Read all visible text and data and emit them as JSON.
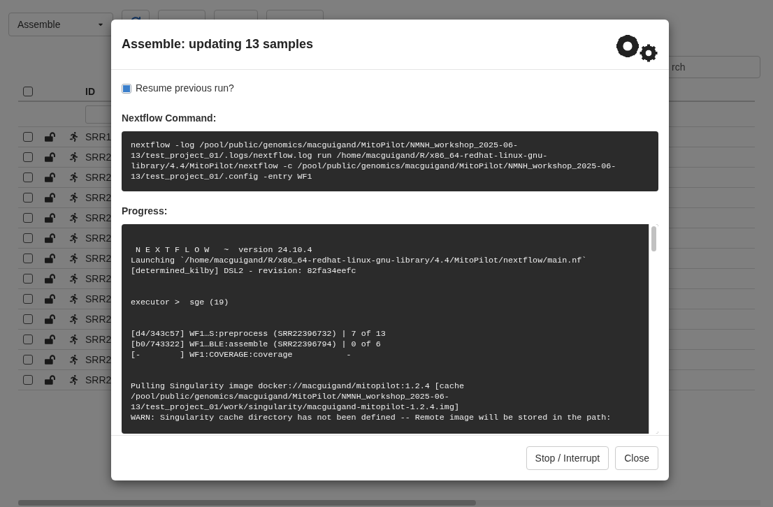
{
  "toolbar": {
    "step_select": "Assemble"
  },
  "search": {
    "placeholder": "rch"
  },
  "table": {
    "header": {
      "checked": false,
      "id_label": "ID"
    },
    "rows": [
      {
        "checked": false,
        "id": "SRR1"
      },
      {
        "checked": false,
        "id": "SRR2"
      },
      {
        "checked": false,
        "id": "SRR2"
      },
      {
        "checked": false,
        "id": "SRR2"
      },
      {
        "checked": false,
        "id": "SRR2"
      },
      {
        "checked": false,
        "id": "SRR2"
      },
      {
        "checked": false,
        "id": "SRR2"
      },
      {
        "checked": false,
        "id": "SRR2"
      },
      {
        "checked": false,
        "id": "SRR2"
      },
      {
        "checked": false,
        "id": "SRR2"
      },
      {
        "checked": false,
        "id": "SRR2"
      },
      {
        "checked": false,
        "id": "SRR2"
      },
      {
        "checked": false,
        "id": "SRR2"
      }
    ]
  },
  "dialog": {
    "title": "Assemble: updating 13 samples",
    "resume": {
      "label": "Resume previous run?",
      "checked": true
    },
    "command_label": "Nextflow Command:",
    "command_lines": [
      "nextflow -log /pool/public/genomics/macguigand/MitoPilot/NMNH_workshop_2025-06-",
      "13/test_project_01/.logs/nextflow.log run /home/macguigand/R/x86_64-redhat-linux-gnu-",
      "library/4.4/MitoPilot/nextflow -c /pool/public/genomics/macguigand/MitoPilot/NMNH_workshop_2025-06-",
      "13/test_project_01/.config -entry WF1"
    ],
    "progress_label": "Progress:",
    "progress_blocks": [
      [
        " N E X T F L O W   ~  version 24.10.4",
        "Launching `/home/macguigand/R/x86_64-redhat-linux-gnu-library/4.4/MitoPilot/nextflow/main.nf`",
        "[determined_kilby] DSL2 - revision: 82fa34eefc"
      ],
      [
        "executor >  sge (19)"
      ],
      [
        "[d4/343c57] WF1…S:preprocess (SRR22396732) | 7 of 13",
        "[b0/743322] WF1…BLE:assemble (SRR22396794) | 0 of 6",
        "[-        ] WF1:COVERAGE:coverage           -"
      ],
      [
        "Pulling Singularity image docker://macguigand/mitopilot:1.2.4 [cache",
        "/pool/public/genomics/macguigand/MitoPilot/NMNH_workshop_2025-06-",
        "13/test_project_01/work/singularity/macguigand-mitopilot-1.2.4.img]",
        "WARN: Singularity cache directory has not been defined -- Remote image will be stored in the path:"
      ]
    ],
    "buttons": [
      "Stop / Interrupt",
      "Close"
    ]
  }
}
